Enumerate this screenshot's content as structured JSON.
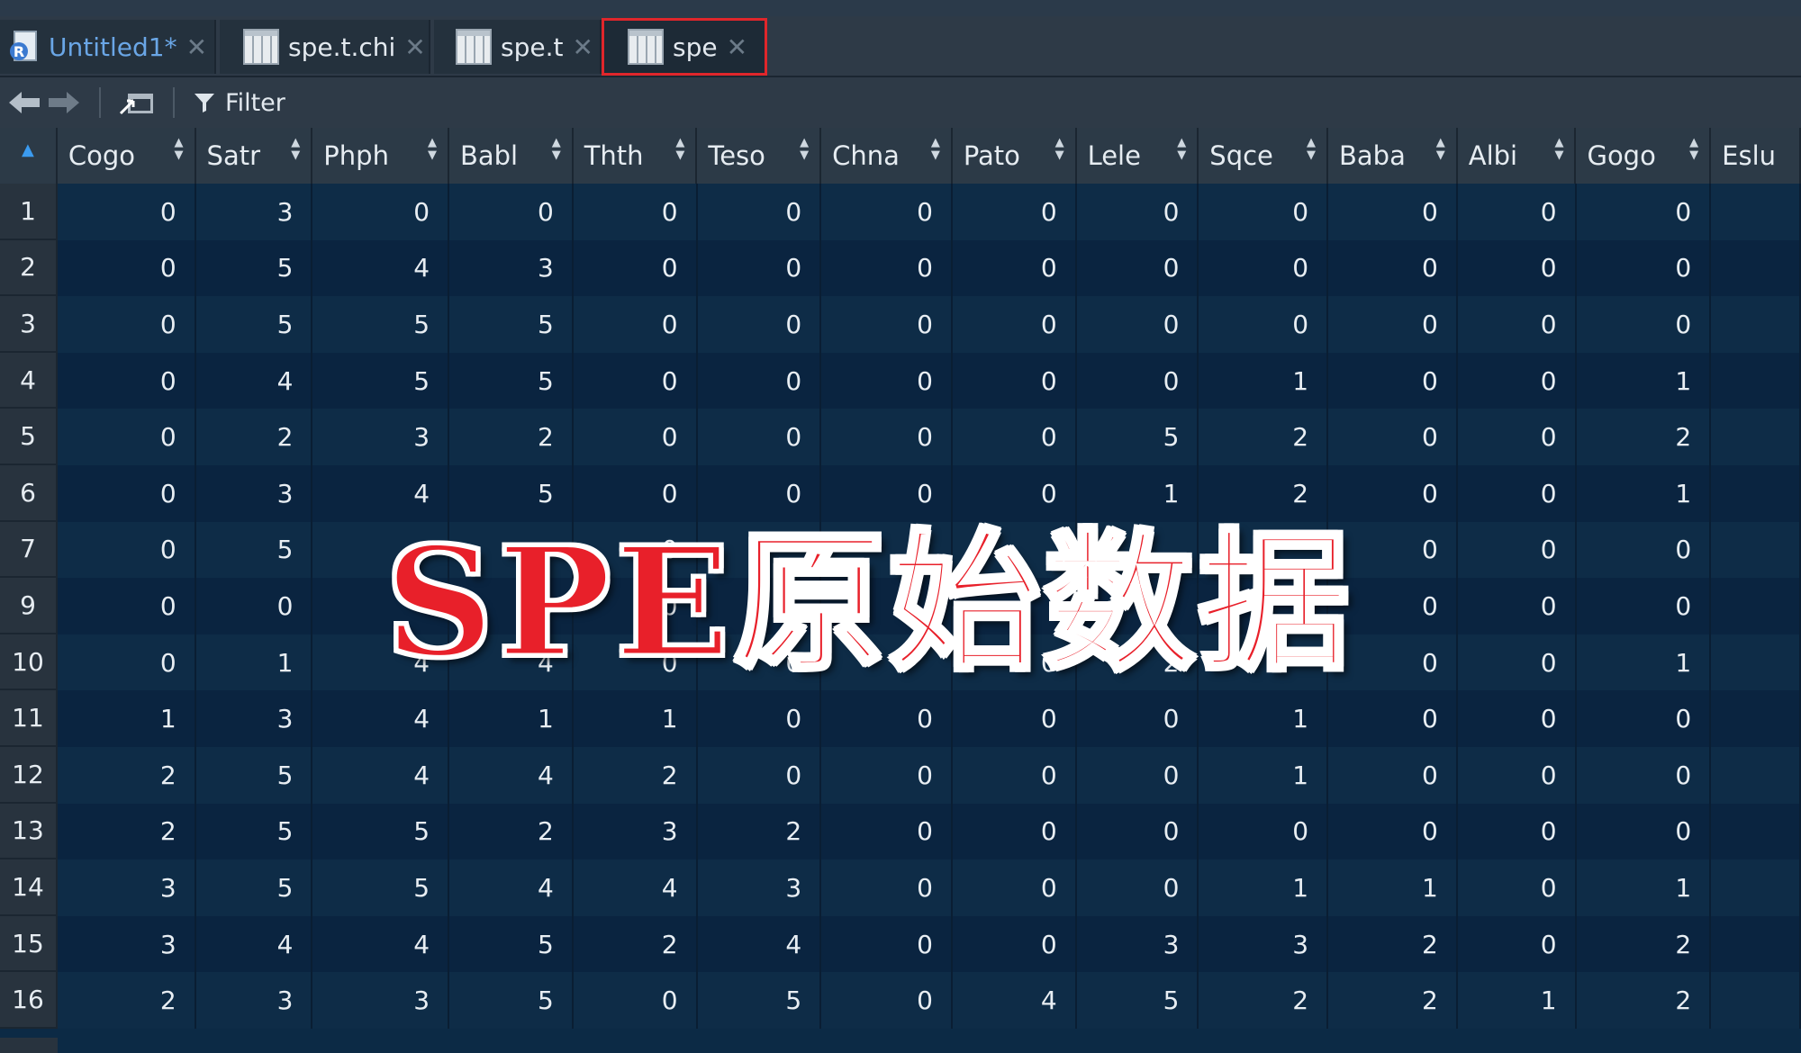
{
  "tabs": [
    {
      "label": "Untitled1*",
      "icon": "r-script-icon",
      "active": false
    },
    {
      "label": "spe.t.chi",
      "icon": "table-icon",
      "active": false
    },
    {
      "label": "spe.t",
      "icon": "table-icon",
      "active": false
    },
    {
      "label": "spe",
      "icon": "table-icon",
      "active": true
    }
  ],
  "toolbar": {
    "filter_label": "Filter"
  },
  "columns": [
    "Cogo",
    "Satr",
    "Phph",
    "Babl",
    "Thth",
    "Teso",
    "Chna",
    "Pato",
    "Lele",
    "Sqce",
    "Baba",
    "Albi",
    "Gogo",
    "Eslu"
  ],
  "rows": [
    {
      "id": "1",
      "cells": [
        "0",
        "3",
        "0",
        "0",
        "0",
        "0",
        "0",
        "0",
        "0",
        "0",
        "0",
        "0",
        "0",
        ""
      ]
    },
    {
      "id": "2",
      "cells": [
        "0",
        "5",
        "4",
        "3",
        "0",
        "0",
        "0",
        "0",
        "0",
        "0",
        "0",
        "0",
        "0",
        ""
      ]
    },
    {
      "id": "3",
      "cells": [
        "0",
        "5",
        "5",
        "5",
        "0",
        "0",
        "0",
        "0",
        "0",
        "0",
        "0",
        "0",
        "0",
        ""
      ]
    },
    {
      "id": "4",
      "cells": [
        "0",
        "4",
        "5",
        "5",
        "0",
        "0",
        "0",
        "0",
        "0",
        "1",
        "0",
        "0",
        "1",
        ""
      ]
    },
    {
      "id": "5",
      "cells": [
        "0",
        "2",
        "3",
        "2",
        "0",
        "0",
        "0",
        "0",
        "5",
        "2",
        "0",
        "0",
        "2",
        ""
      ]
    },
    {
      "id": "6",
      "cells": [
        "0",
        "3",
        "4",
        "5",
        "0",
        "0",
        "0",
        "0",
        "1",
        "2",
        "0",
        "0",
        "1",
        ""
      ]
    },
    {
      "id": "7",
      "cells": [
        "0",
        "5",
        "",
        "",
        "0",
        "",
        "",
        "",
        "",
        "",
        "0",
        "0",
        "0",
        ""
      ]
    },
    {
      "id": "9",
      "cells": [
        "0",
        "0",
        "",
        "3",
        "0",
        "",
        "",
        "",
        "",
        "",
        "0",
        "0",
        "0",
        ""
      ]
    },
    {
      "id": "10",
      "cells": [
        "0",
        "1",
        "4",
        "4",
        "0",
        "0",
        "",
        "0",
        "2",
        "",
        "0",
        "0",
        "1",
        ""
      ]
    },
    {
      "id": "11",
      "cells": [
        "1",
        "3",
        "4",
        "1",
        "1",
        "0",
        "0",
        "0",
        "0",
        "1",
        "0",
        "0",
        "0",
        ""
      ]
    },
    {
      "id": "12",
      "cells": [
        "2",
        "5",
        "4",
        "4",
        "2",
        "0",
        "0",
        "0",
        "0",
        "1",
        "0",
        "0",
        "0",
        ""
      ]
    },
    {
      "id": "13",
      "cells": [
        "2",
        "5",
        "5",
        "2",
        "3",
        "2",
        "0",
        "0",
        "0",
        "0",
        "0",
        "0",
        "0",
        ""
      ]
    },
    {
      "id": "14",
      "cells": [
        "3",
        "5",
        "5",
        "4",
        "4",
        "3",
        "0",
        "0",
        "0",
        "1",
        "1",
        "0",
        "1",
        ""
      ]
    },
    {
      "id": "15",
      "cells": [
        "3",
        "4",
        "4",
        "5",
        "2",
        "4",
        "0",
        "0",
        "3",
        "3",
        "2",
        "0",
        "2",
        ""
      ]
    },
    {
      "id": "16",
      "cells": [
        "2",
        "3",
        "3",
        "5",
        "0",
        "5",
        "0",
        "4",
        "5",
        "2",
        "2",
        "1",
        "2",
        ""
      ]
    }
  ],
  "overlay_title": "SPE原始数据",
  "colors": {
    "accent": "#e0262b",
    "overlay_text": "#e8202a"
  }
}
